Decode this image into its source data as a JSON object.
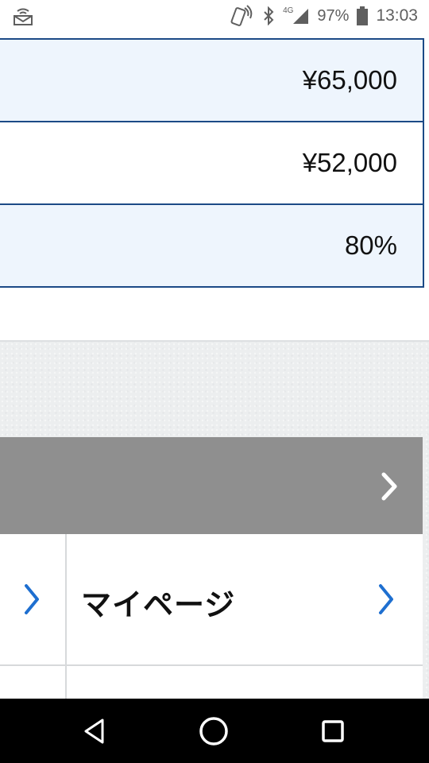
{
  "status_bar": {
    "network_type": "4G",
    "battery_percent": "97%",
    "time": "13:03",
    "icons": [
      "notification-icon",
      "nfc-icon",
      "bluetooth-icon",
      "signal-icon",
      "battery-icon"
    ]
  },
  "price_table": {
    "rows": [
      {
        "value": "¥65,000"
      },
      {
        "value": "¥52,000"
      },
      {
        "value": "80%"
      }
    ]
  },
  "menu": {
    "mypage_label": "マイページ"
  },
  "colors": {
    "table_border": "#1c4a86",
    "row_shade": "#eef5fd",
    "header_bar": "#8f8f8f",
    "chevron_blue": "#1e6fd0"
  },
  "nav_bar": {
    "icons": [
      "back-icon",
      "home-icon",
      "recents-icon"
    ]
  }
}
